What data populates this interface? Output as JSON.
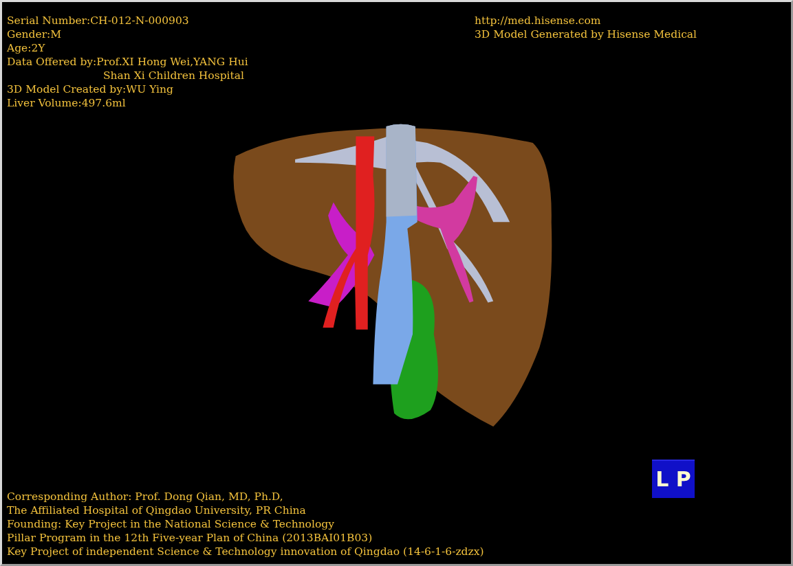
{
  "patient_info": [
    "Serial Number:CH-012-N-000903",
    "Gender:M",
    "Age:2Y",
    "Data Offered by:Prof.XI Hong Wei,YANG Hui",
    "Shan Xi Children Hospital",
    "3D Model Created by:WU Ying",
    "Liver Volume:497.6ml"
  ],
  "header_right": [
    "http://med.hisense.com",
    "3D Model Generated by Hisense Medical"
  ],
  "credits": [
    "Corresponding Author: Prof. Dong Qian, MD, Ph.D,",
    "The Affiliated Hospital of Qingdao University, PR China",
    "Founding: Key Project in the National Science & Technology",
    "Pillar Program in the 12th Five-year Plan of China (2013BAI01B03)",
    "Key Project of independent Science & Technology innovation of Qingdao (14-6-1-6-zdzx)"
  ],
  "orientation_cube": {
    "labels": [
      "L",
      "P"
    ]
  }
}
